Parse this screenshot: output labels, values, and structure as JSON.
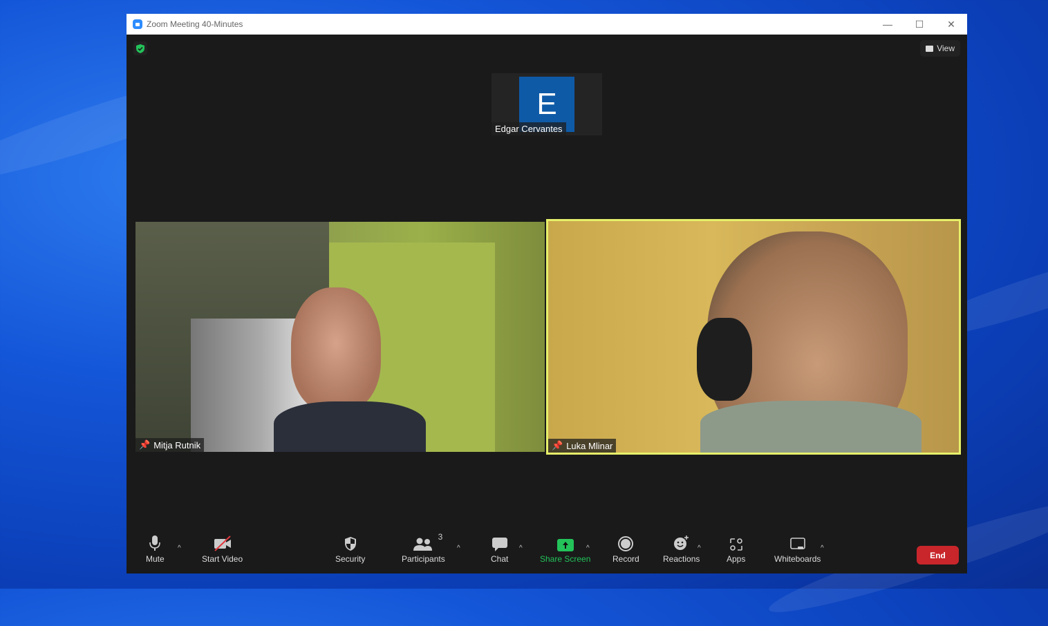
{
  "window": {
    "title": "Zoom Meeting 40-Minutes",
    "controls": {
      "minimize": "—",
      "maximize": "☐",
      "close": "✕"
    }
  },
  "header": {
    "security_badge_icon": "green-shield-check-icon",
    "view_label": "View"
  },
  "participants": [
    {
      "name": "Edgar Cervantes",
      "avatar_initial": "E",
      "video": false,
      "avatar_color": "#0e5aa7"
    },
    {
      "name": "Mitja Rutnik",
      "video": true,
      "pinned": true
    },
    {
      "name": "Luka Mlinar",
      "video": true,
      "pinned": true,
      "active_speaker": true,
      "highlight_color": "#e6f06a"
    }
  ],
  "toolbar": {
    "mute": "Mute",
    "start_video": "Start Video",
    "security": "Security",
    "participants": "Participants",
    "participants_count": "3",
    "chat": "Chat",
    "share_screen": "Share Screen",
    "record": "Record",
    "reactions": "Reactions",
    "apps": "Apps",
    "whiteboards": "Whiteboards",
    "end": "End",
    "caret": "^"
  },
  "colors": {
    "share_green": "#23c35a",
    "end_red": "#c8262b",
    "accent_blue": "#2d8cff"
  }
}
